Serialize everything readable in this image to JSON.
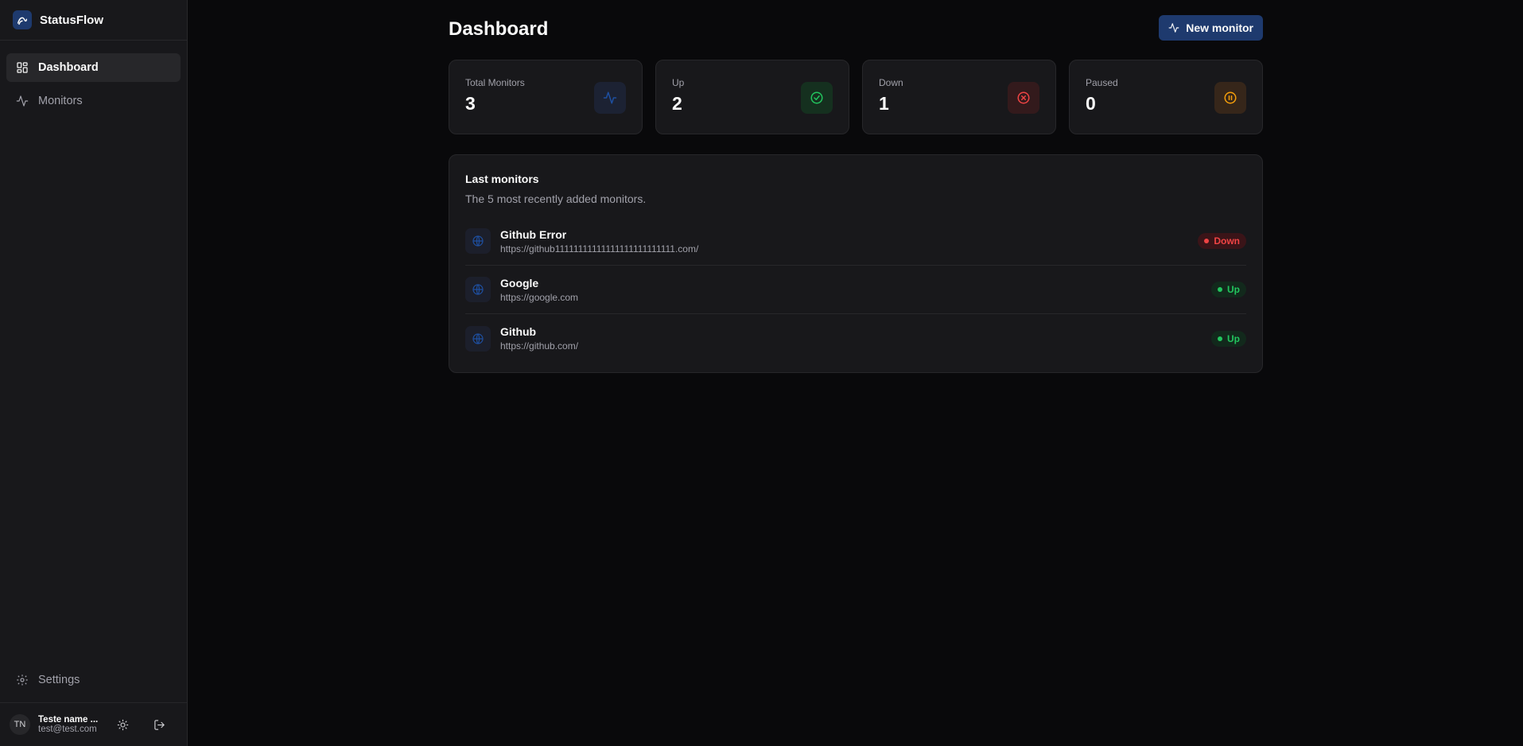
{
  "app": {
    "name": "StatusFlow",
    "logo_icon": "activity-logo-icon"
  },
  "sidebar": {
    "items": [
      {
        "label": "Dashboard",
        "icon": "layout-grid-icon",
        "active": true
      },
      {
        "label": "Monitors",
        "icon": "activity-icon",
        "active": false
      }
    ],
    "settings_label": "Settings",
    "user": {
      "initials": "TN",
      "name": "Teste name ...",
      "email": "test@test.com"
    }
  },
  "header": {
    "title": "Dashboard",
    "new_monitor_label": "New monitor"
  },
  "stats": [
    {
      "label": "Total Monitors",
      "value": "3",
      "icon": "activity-icon",
      "color": "#1e3a6e"
    },
    {
      "label": "Up",
      "value": "2",
      "icon": "check-circle-icon",
      "color": "#22c55e"
    },
    {
      "label": "Down",
      "value": "1",
      "icon": "x-circle-icon",
      "color": "#ef4444"
    },
    {
      "label": "Paused",
      "value": "0",
      "icon": "pause-circle-icon",
      "color": "#f59e0b"
    }
  ],
  "last_monitors": {
    "title": "Last monitors",
    "description": "The 5 most recently added monitors.",
    "rows": [
      {
        "name": "Github Error",
        "url": "https://github11111111111111111111111111.com/",
        "status": "Down"
      },
      {
        "name": "Google",
        "url": "https://google.com",
        "status": "Up"
      },
      {
        "name": "Github",
        "url": "https://github.com/",
        "status": "Up"
      }
    ]
  },
  "colors": {
    "accent": "#1e3a6e",
    "up": "#22c55e",
    "down": "#ef4444",
    "paused": "#f59e0b",
    "background": "#09090b"
  }
}
